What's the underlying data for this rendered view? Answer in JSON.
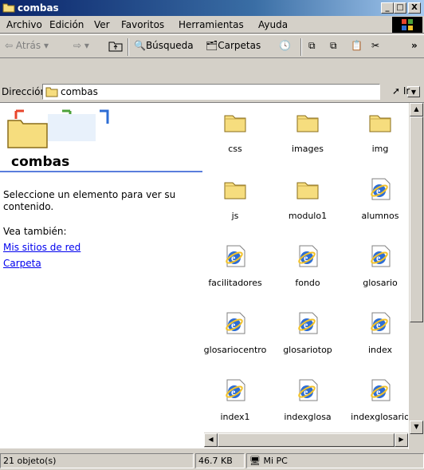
{
  "window": {
    "title": "combas",
    "minimize": "_",
    "maximize": "□",
    "close": "X"
  },
  "menu": [
    "Archivo",
    "Edición",
    "Ver",
    "Favoritos",
    "Herramientas",
    "Ayuda"
  ],
  "toolbar": {
    "back": "Atrás",
    "search": "Búsqueda",
    "folders": "Carpetas",
    "more": "»"
  },
  "address": {
    "label": "Dirección",
    "value": "combas",
    "go": "Ir"
  },
  "side": {
    "folder_name": "combas",
    "prompt": "Seleccione un elemento para ver su contenido.",
    "see_also": "Vea también:",
    "links": [
      "Mis sitios de red",
      "Carpeta"
    ]
  },
  "items": [
    {
      "name": "css",
      "icon": "folder-icon"
    },
    {
      "name": "images",
      "icon": "folder-icon"
    },
    {
      "name": "img",
      "icon": "folder-icon"
    },
    {
      "name": "js",
      "icon": "folder-icon"
    },
    {
      "name": "modulo1",
      "icon": "folder-icon"
    },
    {
      "name": "alumnos",
      "icon": "ie-document-icon"
    },
    {
      "name": "facilitadores",
      "icon": "ie-document-icon"
    },
    {
      "name": "fondo",
      "icon": "ie-document-icon"
    },
    {
      "name": "glosario",
      "icon": "ie-document-icon"
    },
    {
      "name": "glosariocentro",
      "icon": "ie-document-icon"
    },
    {
      "name": "glosariotop",
      "icon": "ie-document-icon"
    },
    {
      "name": "index",
      "icon": "ie-document-icon"
    },
    {
      "name": "index1",
      "icon": "ie-document-icon"
    },
    {
      "name": "indexglosa",
      "icon": "ie-document-icon"
    },
    {
      "name": "indexglosario",
      "icon": "ie-document-icon"
    }
  ],
  "status": {
    "count": "21 objeto(s)",
    "size": "46.7 KB",
    "zone": "Mi PC"
  },
  "colors": {
    "title_start": "#0a246a",
    "title_end": "#a6caf0",
    "face": "#d4d0c8",
    "link": "#0000ee"
  }
}
